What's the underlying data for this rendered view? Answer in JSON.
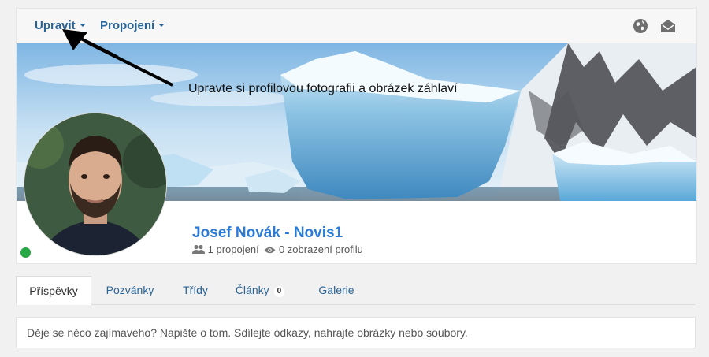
{
  "topnav": {
    "edit_label": "Upravit",
    "connections_label": "Propojení"
  },
  "banner": {
    "hint": "Upravte si profilovou fotografii a obrázek záhlaví"
  },
  "profile": {
    "name": "Josef Novák - Novis1",
    "connections": "1 propojení",
    "views": "0 zobrazení profilu",
    "online_color": "#28a745"
  },
  "tabs": [
    {
      "label": "Příspěvky",
      "active": true
    },
    {
      "label": "Pozvánky"
    },
    {
      "label": "Třídy"
    },
    {
      "label": "Články",
      "badge": "0"
    },
    {
      "label": "Galerie"
    }
  ],
  "composer": {
    "placeholder": "Děje se něco zajímavého? Napište o tom. Sdílejte odkazy, nahrajte obrázky nebo soubory."
  },
  "icons": {
    "globe": "globe-icon",
    "mail": "envelope-open-icon"
  },
  "colors": {
    "link": "#2a6496",
    "name": "#2a7ad6"
  }
}
